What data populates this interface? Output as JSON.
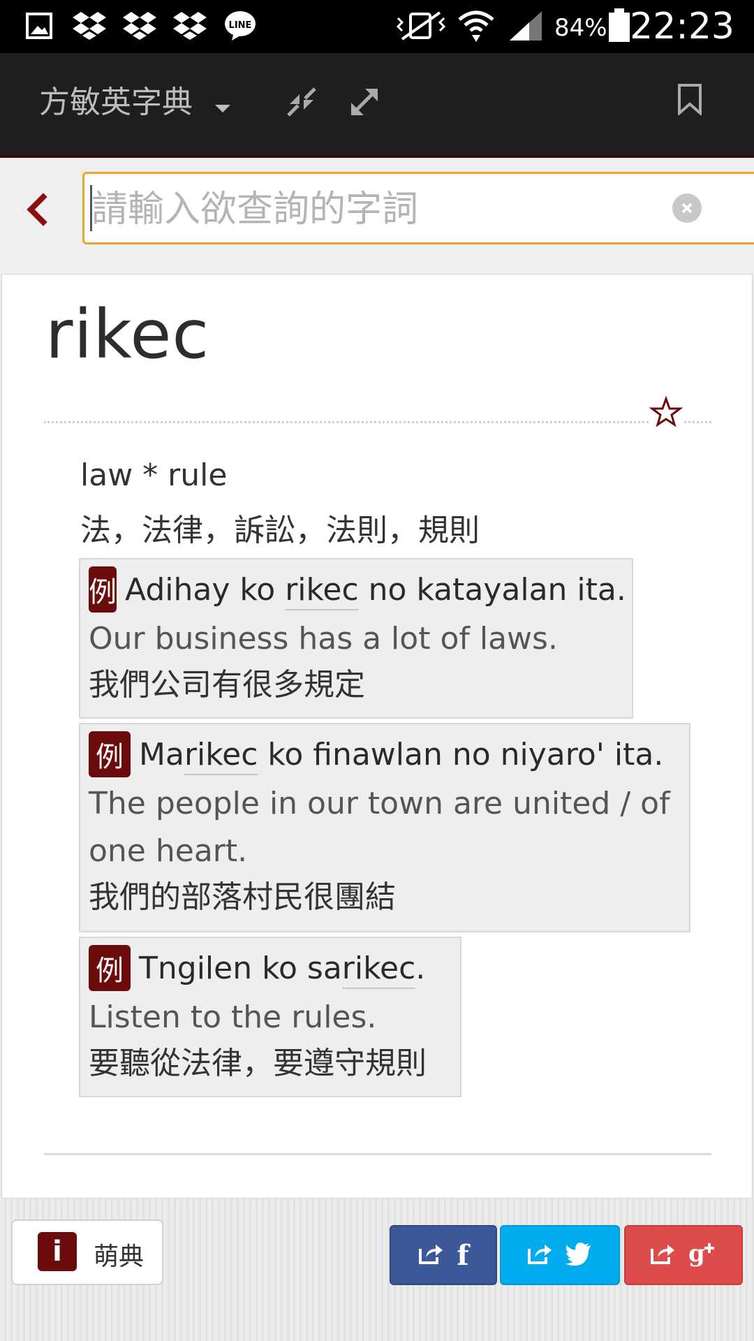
{
  "status_bar": {
    "battery_percent": "84%",
    "time": "22:23",
    "icons": [
      "gallery-icon",
      "dropbox-icon",
      "dropbox-icon",
      "dropbox-icon",
      "line-icon",
      "vibrate-icon",
      "wifi-icon",
      "signal-icon",
      "battery-icon"
    ]
  },
  "toolbar": {
    "title": "方敏英字典",
    "icons": [
      "chevron-down-icon",
      "collapse-icon",
      "expand-icon",
      "bookmark-icon"
    ]
  },
  "search": {
    "placeholder": "請輸入欲查詢的字詞",
    "value": ""
  },
  "entry": {
    "headword": "rikec",
    "definition_en": "law * rule",
    "definition_zh": "法，法律，訴訟，法則，規則",
    "example_badge": "例",
    "examples": [
      {
        "amis_parts": [
          "Adihay ko ",
          "rikec",
          " no katayalan ita."
        ],
        "en": "Our business has a lot of laws.",
        "zh": "我們公司有很多規定"
      },
      {
        "amis_parts": [
          "Ma",
          "rikec",
          " ko finawlan no niyaro' ita."
        ],
        "en_line1": "The people in our town are united / of",
        "en_line2": "one heart.",
        "zh": "我們的部落村民很團結"
      },
      {
        "amis_parts": [
          "Tngilen ko sa",
          "rikec",
          "."
        ],
        "en": "Listen to the rules.",
        "zh": "要聽從法律，要遵守規則"
      }
    ]
  },
  "footer": {
    "moedict_icon_letter": "i",
    "moedict_label": "萌典",
    "share": {
      "facebook_label": "f",
      "colors": {
        "facebook": "#3b5898",
        "twitter": "#00aced",
        "google": "#dd4b4b"
      }
    }
  },
  "colors": {
    "accent": "#6b0b0b",
    "search_border": "#e8a530",
    "toolbar_bg": "#1f1d1d"
  }
}
